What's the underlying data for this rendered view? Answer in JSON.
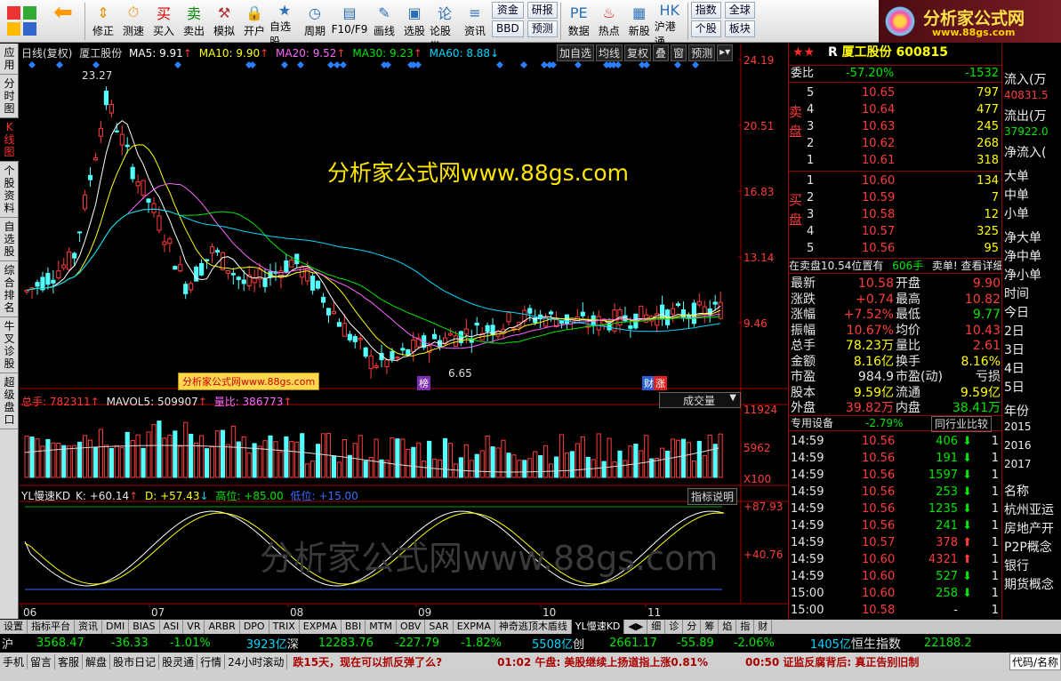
{
  "toolbar": {
    "buttons": [
      {
        "label": "修正",
        "icon": "up-arrow-icon"
      },
      {
        "label": "测速",
        "icon": "stopwatch-icon"
      },
      {
        "label": "买入",
        "icon": "buy-icon"
      },
      {
        "label": "卖出",
        "icon": "sell-icon"
      },
      {
        "label": "模拟",
        "icon": "hammer-icon"
      },
      {
        "label": "开户",
        "icon": "lock-icon"
      },
      {
        "label": "自选股",
        "icon": "star-icon"
      },
      {
        "label": "周期",
        "icon": "clock-icon"
      },
      {
        "label": "F10/F9",
        "icon": "f10-icon"
      },
      {
        "label": "画线",
        "icon": "pen-icon"
      },
      {
        "label": "选股",
        "icon": "monitor-icon"
      },
      {
        "label": "论股堂",
        "icon": "chat-icon"
      },
      {
        "label": "资讯",
        "icon": "news-icon"
      }
    ],
    "small_group1": [
      "资金",
      "BBD"
    ],
    "small_group2": [
      "研报",
      "预测"
    ],
    "buttons2": [
      {
        "label": "数据",
        "icon": "pe-icon"
      },
      {
        "label": "热点",
        "icon": "fire-icon"
      },
      {
        "label": "新股",
        "icon": "new-icon"
      },
      {
        "label": "沪港通",
        "icon": "hk-icon"
      }
    ],
    "small_group3": [
      "指数",
      "个股"
    ],
    "small_group4": [
      "全球",
      "板块"
    ],
    "brand_title": "分析家公式网",
    "brand_url": "www.88gs.com"
  },
  "left_tabs": [
    "应用",
    "分时图",
    "K线图",
    "个股资料",
    "自选股",
    "综合排名",
    "牛叉诊股",
    "超级盘口"
  ],
  "chart": {
    "header": {
      "period": "日线(复权)",
      "stock_name": "厦工股份",
      "ma5": "MA5: 9.91",
      "ma10": "MA10: 9.90",
      "ma20": "MA20: 9.52",
      "ma30": "MA30: 9.23",
      "ma60": "MA60: 8.88"
    },
    "header_buttons": [
      "加自选",
      "均线",
      "复权",
      "叠",
      "窗",
      "预测"
    ],
    "y_labels": [
      "24.19",
      "20.51",
      "16.83",
      "13.14",
      "9.46"
    ],
    "high_marker": "23.27",
    "low_marker": "6.65",
    "watermark_big": "分析家公式网www.88gs.com",
    "watermark_small": "分析家公式网www.88gs.com",
    "tag_bang": "榜",
    "tag_cai": "财",
    "tag_zhang": "涨",
    "volume": {
      "total": "总手: 782311",
      "mavol5": "MAVOL5: 509907",
      "liangbi": "量比: 386773",
      "dropdown": "成交量",
      "y_labels": [
        "11924",
        "5962",
        "X100"
      ]
    },
    "kd": {
      "title": "YL慢速KD",
      "k": "K: +60.14",
      "d": "D: +57.43",
      "high": "高位: +85.00",
      "low": "低位: +15.00",
      "button": "指标说明",
      "y_labels": [
        "+87.93",
        "+40.76"
      ]
    },
    "x_labels": [
      "06",
      "07",
      "08",
      "09",
      "10",
      "11"
    ],
    "watermark_bottom": "分析家公式网www.88gs.com"
  },
  "quote": {
    "title_prefix": "R",
    "title": "厦工股份 600815",
    "weibi_label": "委比",
    "weibi": "-57.20%",
    "weicha": "-1532",
    "sell_label": "卖盘",
    "buy_label": "买盘",
    "asks": [
      {
        "lvl": "5",
        "price": "10.65",
        "vol": "797"
      },
      {
        "lvl": "4",
        "price": "10.64",
        "vol": "477"
      },
      {
        "lvl": "3",
        "price": "10.63",
        "vol": "245"
      },
      {
        "lvl": "2",
        "price": "10.62",
        "vol": "268"
      },
      {
        "lvl": "1",
        "price": "10.61",
        "vol": "318"
      }
    ],
    "bids": [
      {
        "lvl": "1",
        "price": "10.60",
        "vol": "134"
      },
      {
        "lvl": "2",
        "price": "10.59",
        "vol": "7"
      },
      {
        "lvl": "3",
        "price": "10.58",
        "vol": "12"
      },
      {
        "lvl": "4",
        "price": "10.57",
        "vol": "325"
      },
      {
        "lvl": "5",
        "price": "10.56",
        "vol": "95"
      }
    ],
    "notice_left": "在卖盘10.54位置有",
    "notice_mid": "606手",
    "notice_right": "卖单! 查看详细",
    "stats": [
      {
        "l1": "最新",
        "v1": "10.58",
        "c1": "red",
        "l2": "开盘",
        "v2": "9.90",
        "c2": "red"
      },
      {
        "l1": "涨跌",
        "v1": "+0.74",
        "c1": "red",
        "l2": "最高",
        "v2": "10.82",
        "c2": "red"
      },
      {
        "l1": "涨幅",
        "v1": "+7.52%",
        "c1": "red",
        "l2": "最低",
        "v2": "9.77",
        "c2": "grn"
      },
      {
        "l1": "振幅",
        "v1": "10.67%",
        "c1": "red",
        "l2": "均价",
        "v2": "10.43",
        "c2": "red"
      },
      {
        "l1": "总手",
        "v1": "78.23万",
        "c1": "yel",
        "l2": "量比",
        "v2": "2.61",
        "c2": "red"
      },
      {
        "l1": "金额",
        "v1": "8.16亿",
        "c1": "yel",
        "l2": "换手",
        "v2": "8.16%",
        "c2": "yel"
      },
      {
        "l1": "市盈",
        "v1": "984.9",
        "c1": "wht",
        "l2": "市盈(动)",
        "v2": "亏损",
        "c2": "wht"
      },
      {
        "l1": "股本",
        "v1": "9.59亿",
        "c1": "yel",
        "l2": "流通",
        "v2": "9.59亿",
        "c2": "yel"
      },
      {
        "l1": "外盘",
        "v1": "39.82万",
        "c1": "red",
        "l2": "内盘",
        "v2": "38.41万",
        "c2": "grn"
      }
    ],
    "industry": "专用设备",
    "industry_chg": "-2.79%",
    "industry_btn": "同行业比较",
    "ticks": [
      {
        "t": "14:59",
        "p": "10.56",
        "v": "406",
        "dir": "down",
        "n": "1"
      },
      {
        "t": "14:59",
        "p": "10.56",
        "v": "191",
        "dir": "down",
        "n": "1"
      },
      {
        "t": "14:59",
        "p": "10.56",
        "v": "1597",
        "dir": "down",
        "n": "1"
      },
      {
        "t": "14:59",
        "p": "10.56",
        "v": "253",
        "dir": "down",
        "n": "1"
      },
      {
        "t": "14:59",
        "p": "10.56",
        "v": "1235",
        "dir": "down",
        "n": "1"
      },
      {
        "t": "14:59",
        "p": "10.56",
        "v": "241",
        "dir": "down",
        "n": "1"
      },
      {
        "t": "14:59",
        "p": "10.57",
        "v": "378",
        "dir": "up",
        "n": "1"
      },
      {
        "t": "14:59",
        "p": "10.60",
        "v": "4321",
        "dir": "up",
        "n": "1"
      },
      {
        "t": "14:59",
        "p": "10.60",
        "v": "527",
        "dir": "down",
        "n": "1"
      },
      {
        "t": "15:00",
        "p": "10.60",
        "v": "258",
        "dir": "down",
        "n": "1"
      },
      {
        "t": "15:00",
        "p": "10.58",
        "v": "-",
        "dir": "none",
        "n": "1"
      }
    ]
  },
  "extra_panel": {
    "items": [
      "流入(万",
      "40831.5",
      "流出(万",
      "37922.0",
      "净流入(",
      "",
      "大单",
      "中单",
      "小单",
      "",
      "净大单",
      "净中单",
      "净小单",
      "时间",
      "今日",
      "2日",
      "3日",
      "4日",
      "5日",
      "",
      "年份",
      "2015",
      "2016",
      "2017",
      "",
      "名称",
      "杭州亚运",
      "房地产开",
      "P2P概念",
      "银行",
      "期货概念"
    ]
  },
  "bottom_tabs": [
    "设置",
    "指标平台",
    "资讯",
    "DMI",
    "BIAS",
    "ASI",
    "VR",
    "ARBR",
    "DPO",
    "TRIX",
    "EXPMA",
    "BBI",
    "MTM",
    "OBV",
    "SAR",
    "EXPMA",
    "神奇逃顶木盾线",
    "YL慢速KD",
    "细",
    "诊",
    "分",
    "筹",
    "焰",
    "指",
    "财"
  ],
  "index_bar": {
    "sh_label": "沪",
    "sh": "3568.47",
    "sh_chg": "-36.33",
    "sh_pct": "-1.01%",
    "sh_amt": "3923亿",
    "sz_label": "深",
    "sz": "12283.76",
    "sz_chg": "-227.79",
    "sz_pct": "-1.82%",
    "sz_amt": "5508亿",
    "cy_label": "创",
    "cy": "2661.17",
    "cy_chg": "-55.89",
    "cy_pct": "-2.06%",
    "cy_amt": "1405亿",
    "hs_label": "恒生指数",
    "hs": "22188.2"
  },
  "status_bar": {
    "items": [
      "手机",
      "留言",
      "客服",
      "解盘",
      "股市日记",
      "股灵通",
      "行情",
      "24小时滚动"
    ],
    "news1": "跌15天，现在可以抓反弹了么?",
    "news2": "01:02 午盘: 美股继续上扬道指上涨0.81%",
    "news3": "00:50 证监反腐背后: 真正告别旧制",
    "right": "代码/名称"
  }
}
